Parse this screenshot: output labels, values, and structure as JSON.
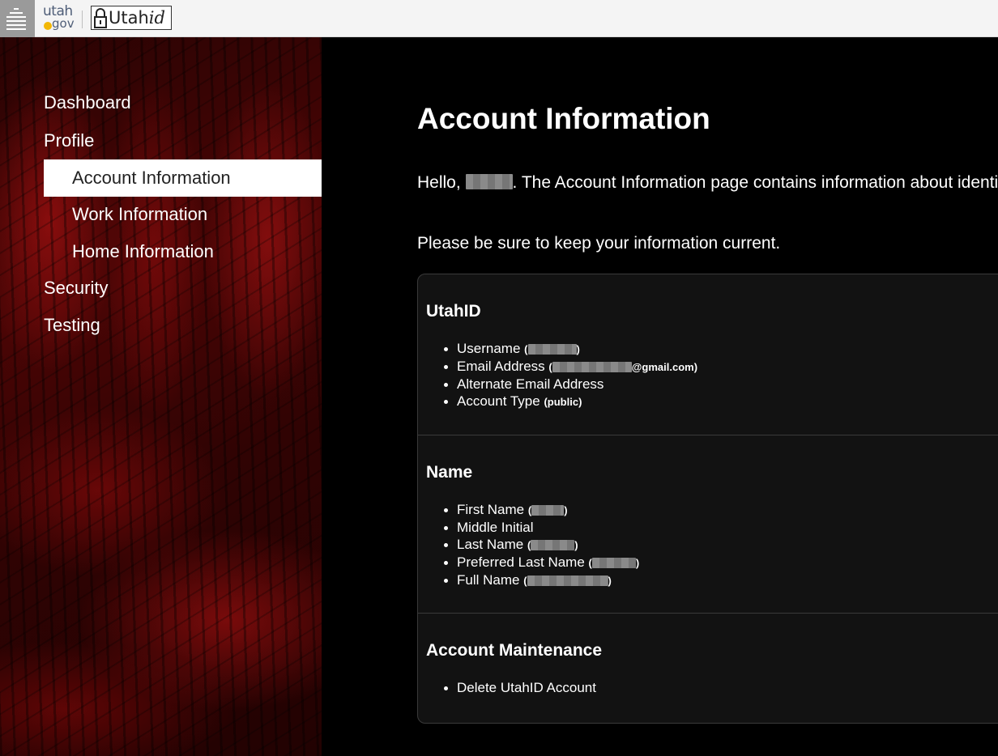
{
  "header": {
    "menu_icon": "hamburger-menu-icon",
    "utah_gov_logo": {
      "top": "utah",
      "bottom": "gov"
    },
    "utahid_logo": {
      "prefix": "Utah",
      "suffix": "id"
    }
  },
  "sidebar": {
    "items": [
      {
        "label": "Dashboard",
        "level": 1
      },
      {
        "label": "Profile",
        "level": 1
      },
      {
        "label": "Account Information",
        "level": 2,
        "active": true
      },
      {
        "label": "Work Information",
        "level": 2
      },
      {
        "label": "Home Information",
        "level": 2
      },
      {
        "label": "Security",
        "level": 1
      },
      {
        "label": "Testing",
        "level": 1
      }
    ]
  },
  "main": {
    "title": "Account Information",
    "intro_prefix": "Hello, ",
    "intro_suffix": ". The Account Information page contains information about identity.",
    "reminder": "Please be sure to keep your information current.",
    "sections": [
      {
        "title": "UtahID",
        "items": [
          {
            "label": "Username",
            "detail_redacted": true
          },
          {
            "label": "Email Address",
            "detail_redacted": true,
            "detail_suffix": "@gmail.com"
          },
          {
            "label": "Alternate Email Address"
          },
          {
            "label": "Account Type",
            "detail": "public"
          }
        ]
      },
      {
        "title": "Name",
        "items": [
          {
            "label": "First Name",
            "detail_redacted": true
          },
          {
            "label": "Middle Initial"
          },
          {
            "label": "Last Name",
            "detail_redacted": true
          },
          {
            "label": "Preferred Last Name",
            "detail_redacted": true
          },
          {
            "label": "Full Name",
            "detail_redacted": true
          }
        ]
      },
      {
        "title": "Account Maintenance",
        "items": [
          {
            "label": "Delete UtahID Account"
          }
        ]
      }
    ]
  },
  "colors": {
    "topbar_bg": "#f4f4f4",
    "menu_button_bg": "#9a9a9a",
    "utah_gov_text": "#4f5e78",
    "utah_gov_dot": "#f2b705",
    "sidebar_accent": "#8b0a0a",
    "active_nav_bg": "#ffffff",
    "card_bg": "#121212"
  }
}
